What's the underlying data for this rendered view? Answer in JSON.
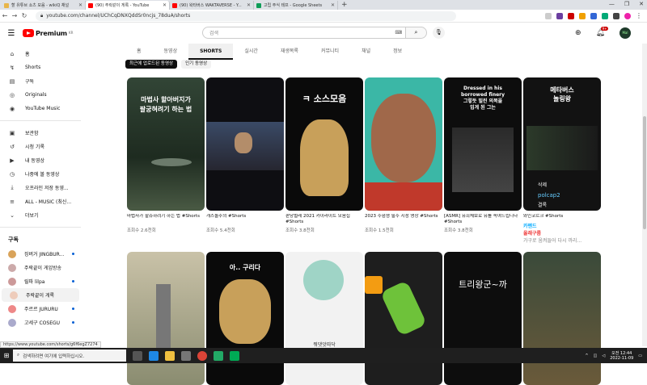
{
  "browser": {
    "tabs": [
      {
        "title": "할 유튜브 쇼츠 모음 - wikiQ 채널",
        "color": "#e8b54a"
      },
      {
        "title": "(90) 주락같이 게록 - YouTube",
        "color": "#ff0000"
      },
      {
        "title": "(90) 왁타버스 WAKTAVERSE - Y...",
        "color": "#ff0000"
      },
      {
        "title": "고립 주식 테프 - Google Sheets",
        "color": "#0f9d58"
      }
    ],
    "new_tab": "+",
    "url": "youtube.com/channel/UChCqDNXQddSr0ncjs_78duA/shorts",
    "window_controls": [
      "—",
      "❐",
      "✕"
    ]
  },
  "header": {
    "logo_text": "Premium",
    "logo_sup": "KR",
    "search_placeholder": "검색",
    "notif_count": "9+",
    "avatar_text": "Mal"
  },
  "sidebar": {
    "top": [
      {
        "label": "홈",
        "icon": "⌂"
      },
      {
        "label": "Shorts",
        "icon": "↯"
      },
      {
        "label": "구독",
        "icon": "▤"
      },
      {
        "label": "Originals",
        "icon": "◎"
      },
      {
        "label": "YouTube Music",
        "icon": "◉"
      }
    ],
    "library": [
      {
        "label": "보관함",
        "icon": "▣"
      },
      {
        "label": "시청 기록",
        "icon": "↺"
      },
      {
        "label": "내 동영상",
        "icon": "▶"
      },
      {
        "label": "나중에 볼 동영상",
        "icon": "◷"
      },
      {
        "label": "오프라인 저장 동영...",
        "icon": "⤓"
      },
      {
        "label": "ALL - MUSIC (최신...",
        "icon": "≡"
      },
      {
        "label": "더보기",
        "icon": "⌄"
      }
    ],
    "subs_title": "구독",
    "subs": [
      {
        "label": "징버거 JINGBUR...",
        "color": "#d9a35a",
        "dot": true
      },
      {
        "label": "주락끝이 게임방송",
        "color": "#caa",
        "dot": false
      },
      {
        "label": "릴파 lilpa",
        "color": "#c99",
        "dot": true
      },
      {
        "label": "주락끝이 게록",
        "color": "#ecb",
        "dot": false
      },
      {
        "label": "주르르 JURURU",
        "color": "#e88",
        "dot": true
      },
      {
        "label": "고세구 COSEGU",
        "color": "#aac",
        "dot": true
      }
    ]
  },
  "channel_tabs": [
    {
      "label": "홈",
      "active": false
    },
    {
      "label": "동영상",
      "active": false
    },
    {
      "label": "SHORTS",
      "active": true
    },
    {
      "label": "실시간",
      "active": false
    },
    {
      "label": "재생목록",
      "active": false
    },
    {
      "label": "커뮤니티",
      "active": false
    },
    {
      "label": "채널",
      "active": false
    },
    {
      "label": "정보",
      "active": false
    }
  ],
  "chips": [
    {
      "label": "최근에 업로드된 동영상",
      "active": true
    },
    {
      "label": "인기 동영상",
      "active": false
    }
  ],
  "shorts": [
    {
      "title": "마법사가 할슈하려기 하는 법 #Shorts",
      "views": "조회수 2.6천회",
      "overlay": "마법사 할아버지가\n팔궁혀려기 하는 법",
      "bg": "#2b3a2e"
    },
    {
      "title": "개스돌주의 #Shorts",
      "views": "조회수 5.4천회",
      "overlay": "",
      "bg": "#1a1a20"
    },
    {
      "title": "판당벌레 2021 카이라이트 모음집 #Shorts",
      "views": "조회수 3.8천회",
      "overlay": "ㅋ 소스모음",
      "bg": "#111"
    },
    {
      "title": "2023 수험생 필수 시청 영상 #Shorts",
      "views": "조회수 1.5천회",
      "overlay": "",
      "bg": "#3bb7a6"
    },
    {
      "title": "[ASMR] 유희체보로 유를 속여드립니다 #Shorts",
      "views": "조회수 3.8천회",
      "overlay": "Dressed in his\nborrowed finery\n그렇듯 빌린 의복을\n입게 된 그는",
      "bg": "#0d0d0d"
    },
    {
      "title": "와인코르크 #Shorts",
      "views": "",
      "overlay": "메타버스\n놀링왕",
      "bg": "#111",
      "extra": [
        "삭제",
        "polcap2",
        "결록",
        "카멘드",
        "올래구름",
        "가구로 움켜들어 다시 까리..."
      ]
    }
  ],
  "shorts_row2_overlays": [
    "",
    "아.. 구리다",
    "뭐댓앗따닥",
    "",
    "트리왕군~까",
    ""
  ],
  "status_url": "https://www.youtube.com/shorts/g6f6egZ7274",
  "taskbar": {
    "search_placeholder": "검색하려면 여기에 입력하십시오.",
    "time": "오전 12:44",
    "date": "2022-11-09"
  }
}
